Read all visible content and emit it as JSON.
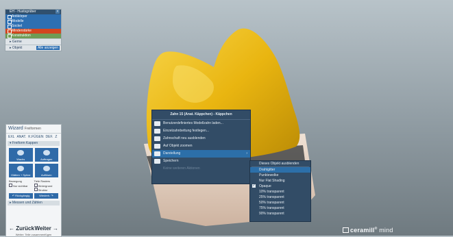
{
  "tree": {
    "header": "EH - Hustsgrüber",
    "rows": [
      {
        "label": "Antikörper",
        "color": "blue",
        "checked": true
      },
      {
        "label": "Modelle",
        "color": "blue",
        "checked": false
      },
      {
        "label": "Sockel",
        "color": "blue",
        "checked": true
      },
      {
        "label": "Minderstärke",
        "color": "red",
        "checked": true
      },
      {
        "label": "Konstruktion",
        "color": "green",
        "checked": true
      }
    ],
    "section_1": "Gerne",
    "section_2": "Objekt",
    "section_2_button": "Alle anzeigen"
  },
  "wizard": {
    "title": "Wizard",
    "subtitle": "Freiformen",
    "tabs": [
      "EXL",
      "ANAT.",
      "K.FÜGEN",
      "DEF.",
      "Z"
    ],
    "section": "Freiform Kappen",
    "tiles": [
      {
        "label": "Wachs"
      },
      {
        "label": "Auftragen"
      },
      {
        "label": "Glätten + Spline"
      },
      {
        "label": "Auflösen"
      }
    ],
    "options_left_title": "Bewegung",
    "options_left": [
      "Nur sichtbar"
    ],
    "options_right_title": "Tiefe Rasters",
    "options_right": [
      "Hintergrund",
      "Struktur"
    ],
    "btn_undo": "Rückgängig",
    "btn_redo": "Wiederh.",
    "section_2": "Messen und Zählen",
    "back": "Zurück",
    "next": "Weiter",
    "footer": "Weiter: Teile zusammenfügen"
  },
  "context_menu": {
    "title": "Zahn 15 (Anat. Käppchen) - Käppchen",
    "items": [
      {
        "label": "Benutzerdefiniertes Modellzahn laden...",
        "icon": "load-model-icon",
        "state": "normal"
      },
      {
        "label": "Einzelzahnbettung festlegen...",
        "icon": "tooth-icon",
        "state": "normal"
      },
      {
        "label": "Zahnschaft neu ausblenden",
        "icon": "tooth-icon",
        "state": "normal"
      },
      {
        "label": "Auf Objekt zoomen",
        "icon": "zoom-icon",
        "state": "normal"
      },
      {
        "label": "Darstellung",
        "icon": "eye-icon",
        "state": "selected",
        "submenu": true
      },
      {
        "label": "Speichern",
        "icon": "save-icon",
        "state": "normal"
      },
      {
        "label": "Keine weiteren Aktionen",
        "icon": "",
        "state": "disabled"
      }
    ]
  },
  "submenu": {
    "items": [
      {
        "label": "Dieses Objekt ausblenden",
        "selected": false,
        "checked": false
      },
      {
        "label": "Drahtgitter",
        "selected": true,
        "checked": false
      },
      {
        "label": "Punktewolke",
        "selected": false,
        "checked": false
      },
      {
        "label": "Nur Flat Shading",
        "selected": false,
        "checked": false
      },
      {
        "label": "Opaque",
        "selected": false,
        "checked": true
      },
      {
        "label": "10% transparent",
        "selected": false,
        "checked": false
      },
      {
        "label": "25% transparent",
        "selected": false,
        "checked": false
      },
      {
        "label": "50% transparent",
        "selected": false,
        "checked": false
      },
      {
        "label": "75% transparent",
        "selected": false,
        "checked": false
      },
      {
        "label": "90% transparent",
        "selected": false,
        "checked": false
      }
    ]
  },
  "logo": {
    "brand": "ceramill",
    "product": "mind"
  },
  "colors": {
    "crown": "#f2c11c",
    "menu_bg": "#324c66",
    "menu_sel": "#2c6fa9",
    "accent_red": "#d3461f"
  }
}
